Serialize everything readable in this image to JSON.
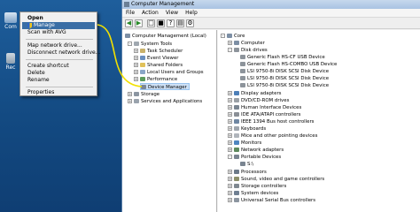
{
  "desktop": {
    "icon1_label": "Com",
    "icon2_label": "Rec"
  },
  "context_menu": {
    "items": [
      "Open",
      "Manage",
      "Scan with AVG",
      "Map network drive...",
      "Disconnect network drive...",
      "Create shortcut",
      "Delete",
      "Rename",
      "Properties"
    ]
  },
  "window": {
    "title": "Computer Management",
    "menu": [
      "File",
      "Action",
      "View",
      "Help"
    ]
  },
  "left_tree": [
    "Computer Management (Local)",
    "System Tools",
    "Task Scheduler",
    "Event Viewer",
    "Shared Folders",
    "Local Users and Groups",
    "Performance",
    "Device Manager",
    "Storage",
    "Services and Applications"
  ],
  "right_tree": [
    "Core",
    "Computer",
    "Disk drives",
    "Generic Flash HS-CF USB Device",
    "Generic Flash HS-COMBO USB Device",
    "LSI 9750-8i     DISK SCSI Disk Device",
    "LSI 9750-8i     DISK SCSI Disk Device",
    "LSI 9750-8i     DISK SCSI Disk Device",
    "Display adapters",
    "DVD/CD-ROM drives",
    "Human Interface Devices",
    "IDE ATA/ATAPI controllers",
    "IEEE 1394 Bus host controllers",
    "Keyboards",
    "Mice and other pointing devices",
    "Monitors",
    "Network adapters",
    "Portable Devices",
    "S:\\",
    "Processors",
    "Sound, video and game controllers",
    "Storage controllers",
    "System devices",
    "Universal Serial Bus controllers"
  ],
  "colors": {
    "desktop": "#17528f",
    "menu_highlight": "#3a6ea5",
    "callout": "#f2e000"
  }
}
